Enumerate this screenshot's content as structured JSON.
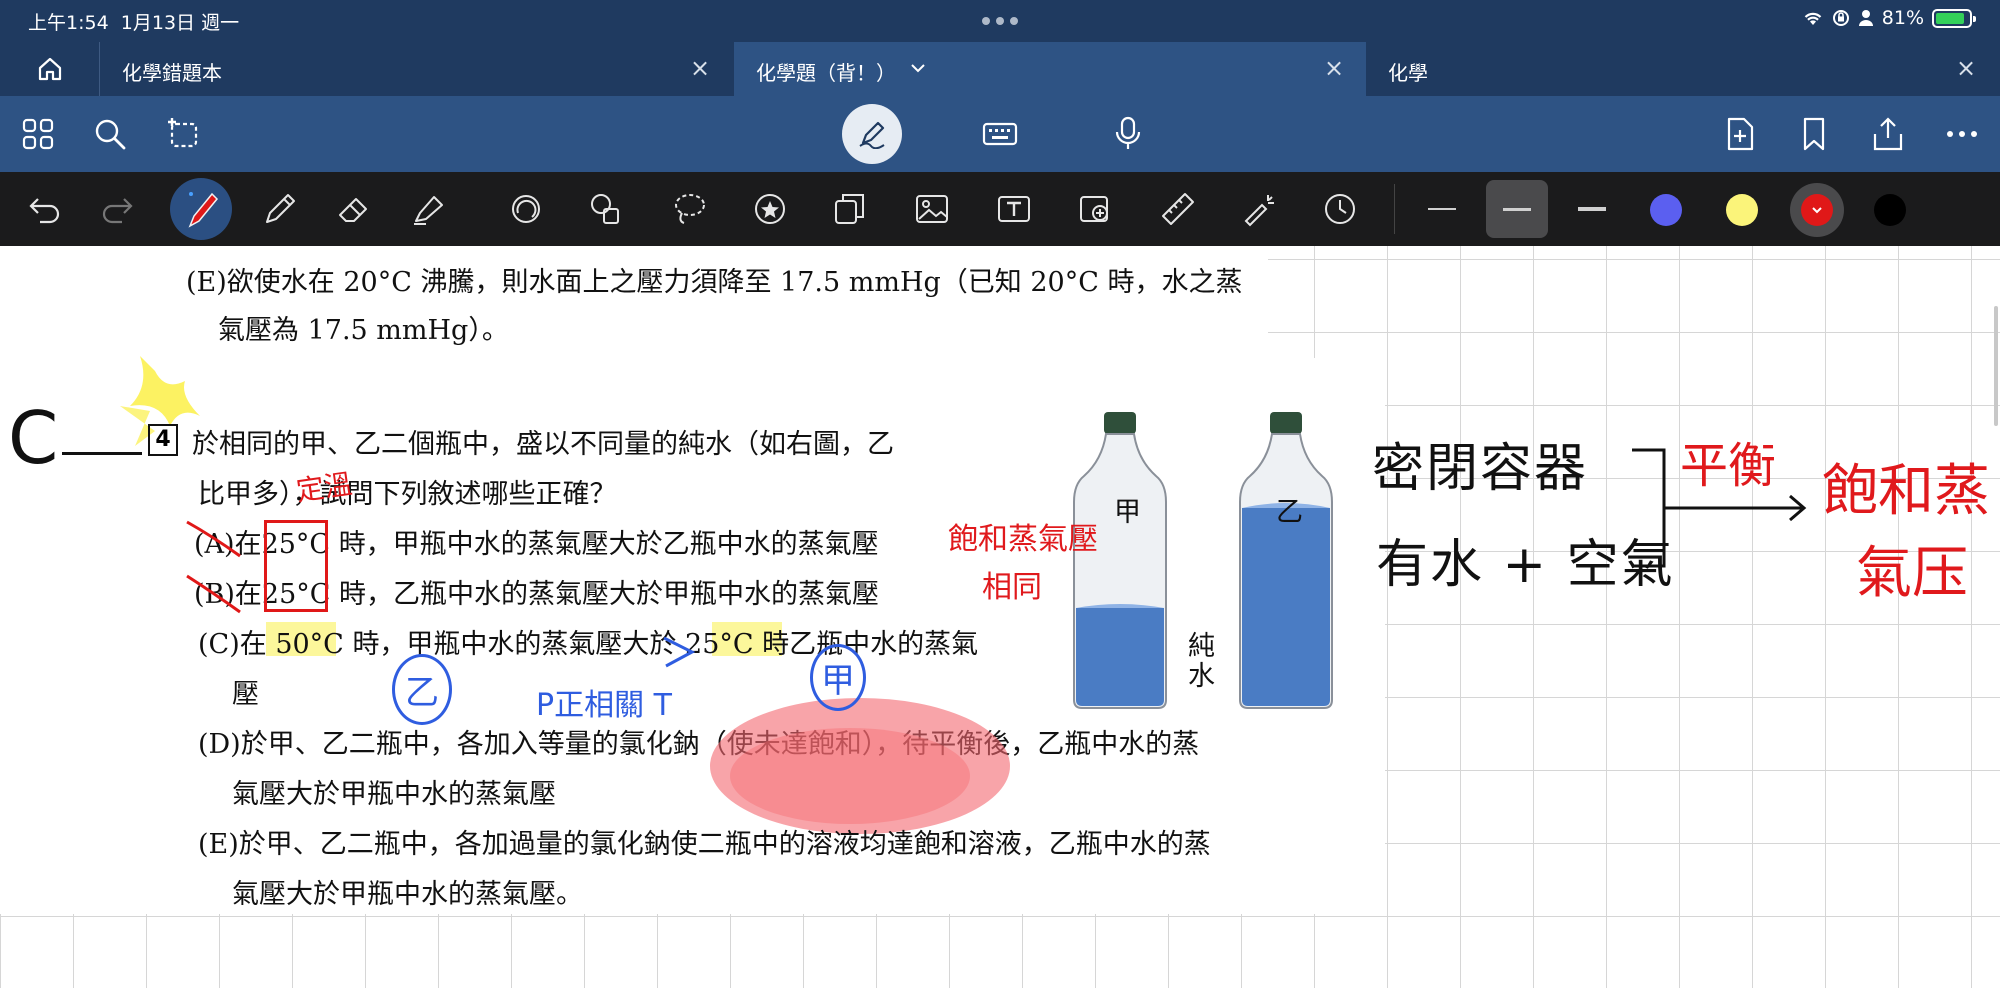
{
  "status": {
    "time": "上午1:54",
    "date": "1月13日 週一",
    "battery": "81%"
  },
  "tabs": [
    {
      "label": "化學錯題本"
    },
    {
      "label": "化學題（背！）"
    },
    {
      "label": "化學"
    }
  ],
  "colors": {
    "chrome": "#1f3a60",
    "toolbar": "#2e5384",
    "pen_toolbar": "#1b1b1c",
    "swatches": [
      "#5b5ff0",
      "#fbf47a",
      "#e01818",
      "#000000"
    ]
  },
  "toolbar_icons": [
    "grid-icon",
    "search-icon",
    "lasso-add-icon",
    "pen-mode-icon",
    "keyboard-icon",
    "microphone-icon",
    "new-page-icon",
    "bookmark-icon",
    "share-icon",
    "more-icon"
  ],
  "pen_tools": [
    "undo-icon",
    "redo-icon",
    "fountain-pen-icon",
    "pencil-icon",
    "eraser-icon",
    "highlighter-icon",
    "shape-icon",
    "elements-icon",
    "lasso-icon",
    "sticker-icon",
    "copy-icon",
    "image-icon",
    "text-box-icon",
    "camera-icon",
    "ruler-icon",
    "laser-pointer-icon",
    "history-icon"
  ],
  "page": {
    "prev_E_line1": "(E)欲使水在 20°C 沸騰，則水面上之壓力須降至 17.5 mmHg（已知 20°C 時，水之蒸",
    "prev_E_line2": "氣壓為 17.5 mmHg）。",
    "q_number": "4",
    "q_line1": "於相同的甲、乙二個瓶中，盛以不同量的純水（如右圖，乙",
    "q_line2_a": "比甲多），",
    "q_line2_b": "試問下列敘述哪些正確？",
    "opt_A_prefix": "(A)在",
    "opt_A_temp": "25°C",
    "opt_A_rest": "時，甲瓶中水的蒸氣壓大於乙瓶中水的蒸氣壓",
    "opt_B_prefix": "(B)在",
    "opt_B_temp": "25°C",
    "opt_B_rest": "時，乙瓶中水的蒸氣壓大於甲瓶中水的蒸氣壓",
    "opt_C_prefix": "(C)在",
    "opt_C_temp1": "50°C",
    "opt_C_mid": "時，甲瓶中水的蒸氣壓大於",
    "opt_C_temp2": "25°C",
    "opt_C_rest": "時乙瓶中水的蒸氣",
    "opt_C_line2": "壓",
    "opt_D_line1": "(D)於甲、乙二瓶中，各加入等量的氯化鈉（使未達飽和），待平衡後，乙瓶中水的蒸",
    "opt_D_line2": "氣壓大於甲瓶中水的蒸氣壓",
    "opt_E_line1": "(E)於甲、乙二瓶中，各加過量的氯化鈉使二瓶中的溶液均達飽和溶液，乙瓶中水的蒸",
    "opt_E_line2": "氣壓大於甲瓶中水的蒸氣壓。",
    "bottle_jia": "甲",
    "bottle_yi": "乙",
    "pure_water": "純\n水"
  },
  "handwriting": {
    "answer": "C",
    "fixed_temp": "定溫",
    "sat_vp": "飽和蒸氣壓",
    "same": "相同",
    "yi_circle": "乙",
    "jia_circle": "甲",
    "p_relation": "P正相關 T",
    "closed_container": "密閉容器",
    "water_air": "有水 + 空氣",
    "equilibrium": "平衡",
    "sat_vapor_pressure_1": "飽和蒸",
    "sat_vapor_pressure_2": "氣压"
  }
}
